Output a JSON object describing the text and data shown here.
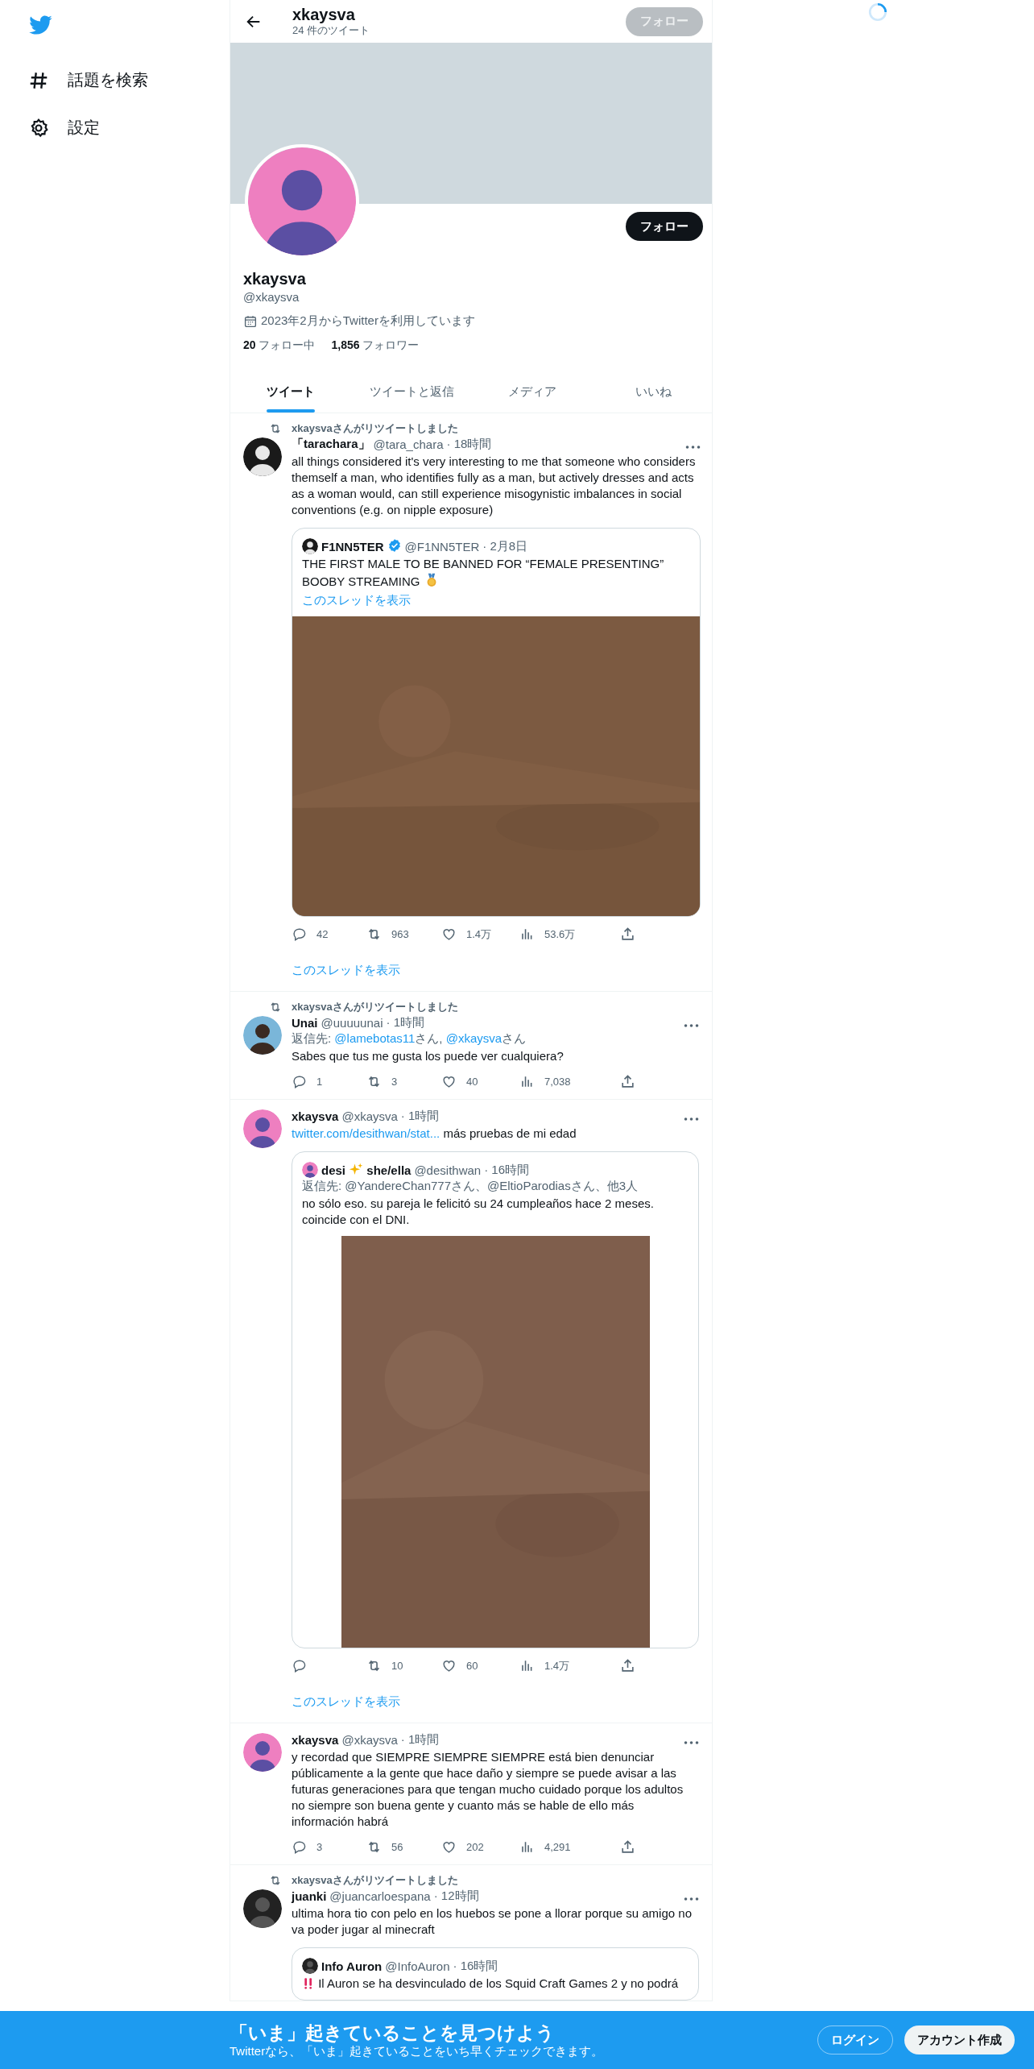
{
  "sidebar": {
    "items": [
      {
        "label": "話題を検索",
        "kind": "explore"
      },
      {
        "label": "設定",
        "kind": "settings"
      }
    ]
  },
  "header": {
    "title": "xkaysva",
    "subtitle": "24 件のツイート",
    "follow_button": {
      "label": "フォロー",
      "disabled": true
    }
  },
  "profile": {
    "follow_button": "フォロー",
    "name": "xkaysva",
    "handle": "@xkaysva",
    "joined": "2023年2月からTwitterを利用しています",
    "following": "**20** フォロー中",
    "followers": "**1,856** フォロワー"
  },
  "tabs": [
    {
      "label": "ツイート",
      "selected": true
    },
    {
      "label": "ツイートと返信",
      "selected": false
    },
    {
      "label": "メディア",
      "selected": false
    },
    {
      "label": "いいね",
      "selected": false
    }
  ],
  "tweets": [
    {
      "retweeted_by": "xkaysvaさんがリツイートしました",
      "name": "「tarachara」",
      "handle": "@tara_chara",
      "time": "· 18時間",
      "text": [
        {
          "kind": "text",
          "text": "all things considered it's very interesting to me that someone who considers themself a man, who identifies fully as a man, but actively dresses and acts as a woman would, can still experience misogynistic imbalances in social conventions (e.g. on nipple exposure)"
        }
      ],
      "quote": {
        "name": [
          {
            "kind": "text",
            "text": "F1NN5TER"
          }
        ],
        "verified": true,
        "handle": "@F1NN5TER",
        "time": "· 2月8日",
        "text": [
          {
            "kind": "text",
            "text": "THE FIRST MALE TO BE BANNED FOR “FEMALE PRESENTING” BOOBY STREAMING "
          },
          {
            "kind": "medal"
          }
        ],
        "show_thread": "このスレッドを表示",
        "media": {
          "kind": "picture",
          "tall": false
        }
      },
      "stats": {
        "reply": "42",
        "retweet": "963",
        "like": "1.4万",
        "views": "53.6万"
      },
      "show_thread": "このスレッドを表示"
    },
    {
      "retweeted_by": "xkaysvaさんがリツイートしました",
      "name": "Unai",
      "handle": "@uuuuunai",
      "time": "· 1時間",
      "reply_to": [
        {
          "kind": "text",
          "text": "返信先: "
        },
        {
          "kind": "link",
          "text": "@lamebotas11"
        },
        {
          "kind": "text",
          "text": "さん, "
        },
        {
          "kind": "link",
          "text": "@xkaysva"
        },
        {
          "kind": "text",
          "text": "さん"
        }
      ],
      "text": [
        {
          "kind": "text",
          "text": "Sabes que tus me gusta los puede ver cualquiera?"
        }
      ],
      "stats": {
        "reply": "1",
        "retweet": "3",
        "like": "40",
        "views": "7,038"
      }
    },
    {
      "name": "xkaysva",
      "handle": "@xkaysva",
      "time": "· 1時間",
      "text": [
        {
          "kind": "link",
          "text": "twitter.com/desithwan/stat..."
        },
        {
          "kind": "text",
          "text": " más pruebas de mi edad"
        }
      ],
      "quote": {
        "name": [
          {
            "kind": "text",
            "text": "desi "
          },
          {
            "kind": "sparkle"
          },
          {
            "kind": "text",
            "text": " she/ella"
          }
        ],
        "verified": false,
        "handle": "@desithwan",
        "time": "· 16時間",
        "reply_to": [
          {
            "kind": "text",
            "text": "返信先: @YandereChan777さん、@EltioParodiasさん、他3人"
          }
        ],
        "text": [
          {
            "kind": "text",
            "text": "no sólo eso. su pareja le felicitó su 24 cumpleaños hace 2 meses. coincide con el DNI."
          }
        ],
        "media": {
          "kind": "picture",
          "tall": true
        }
      },
      "stats": {
        "retweet": "10",
        "like": "60",
        "views": "1.4万"
      },
      "show_thread": "このスレッドを表示"
    },
    {
      "name": "xkaysva",
      "handle": "@xkaysva",
      "time": "· 1時間",
      "text": [
        {
          "kind": "text",
          "text": "y recordad que SIEMPRE SIEMPRE SIEMPRE está bien denunciar públicamente a la gente que hace daño y siempre se puede avisar a las futuras generaciones para que tengan mucho cuidado porque los adultos no siempre son buena gente y cuanto más se hable de ello más información habrá"
        }
      ],
      "stats": {
        "reply": "3",
        "retweet": "56",
        "like": "202",
        "views": "4,291"
      }
    },
    {
      "retweeted_by": "xkaysvaさんがリツイートしました",
      "name": "juanki",
      "handle": "@juancarloespana",
      "time": "· 12時間",
      "text": [
        {
          "kind": "text",
          "text": "ultima hora tio con pelo en los huebos se pone a llorar porque su amigo no va poder jugar al minecraft"
        }
      ],
      "quote": {
        "name": [
          {
            "kind": "text",
            "text": "Info Auron"
          }
        ],
        "verified": false,
        "handle": "@InfoAuron",
        "time": "· 16時間",
        "text": [
          {
            "kind": "alert"
          },
          {
            "kind": "text",
            "text": " Il Auron se ha desvinculado de los Squid Craft Games 2 y no podrá"
          }
        ]
      }
    }
  ],
  "signup_bar": {
    "title": "「いま」起きていることを見つけよう",
    "subtitle": "Twitterなら、「いま」起きていることをいち早くチェックできます。",
    "buttons": [
      {
        "label": "ログイン",
        "kind": "outline"
      },
      {
        "label": "アカウント作成",
        "kind": "filled"
      }
    ]
  }
}
